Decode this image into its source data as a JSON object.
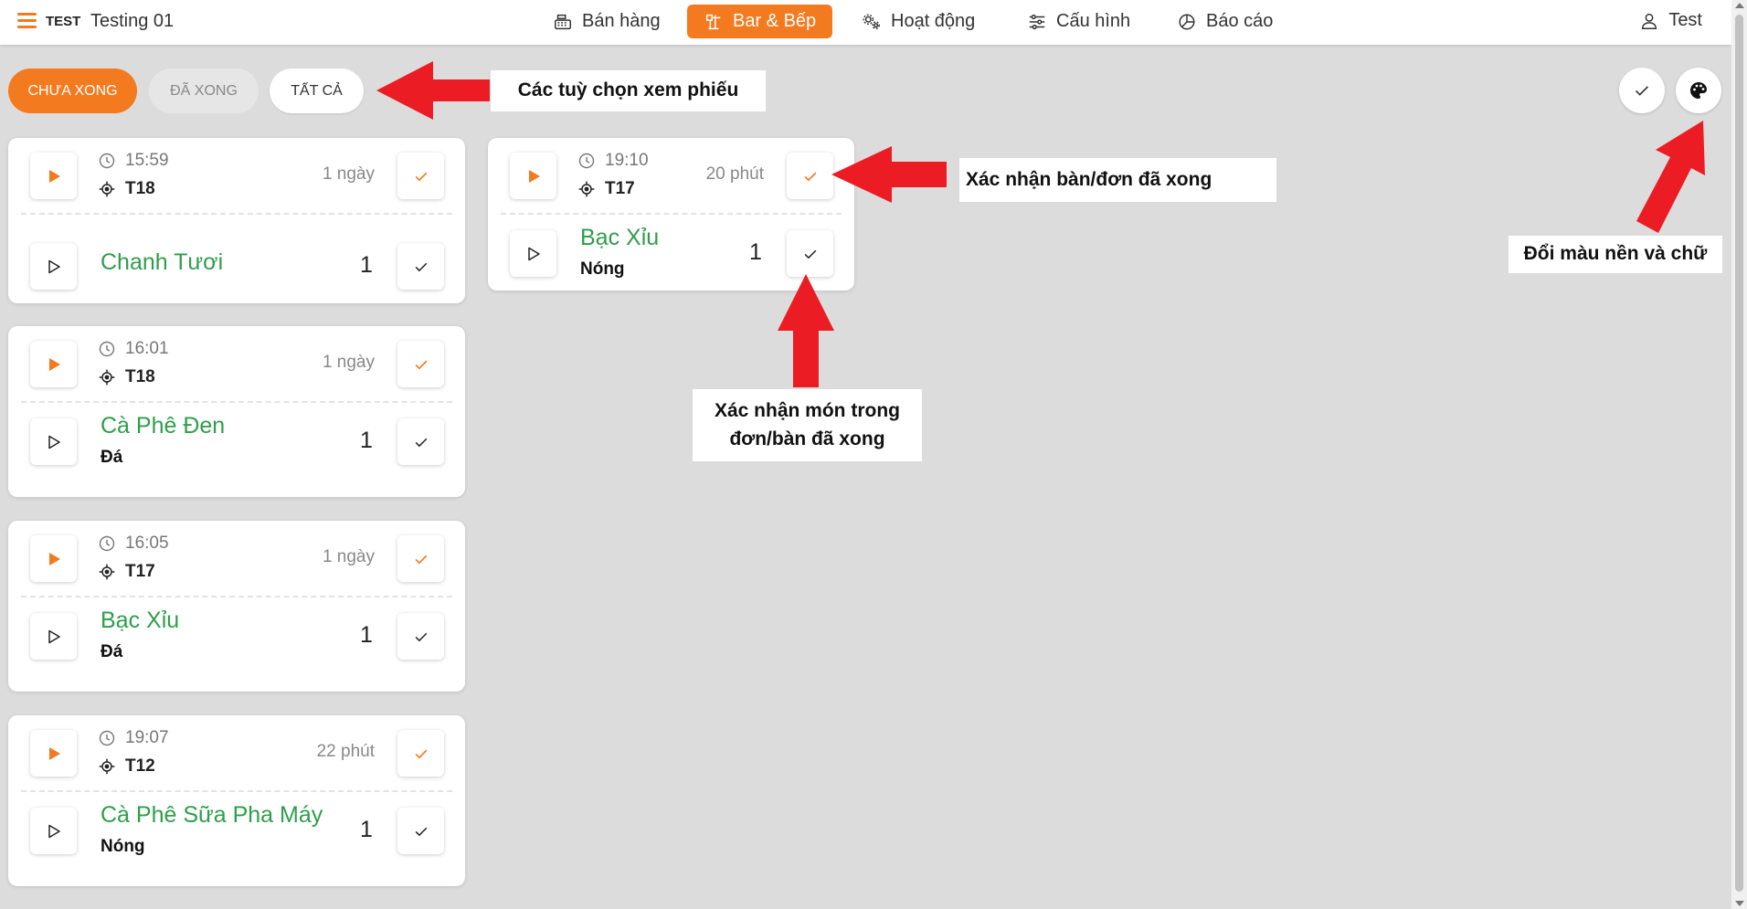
{
  "header": {
    "brand": "TEST",
    "store_name": "Testing 01",
    "nav": [
      {
        "label": "Bán hàng",
        "icon": "cash-register-icon"
      },
      {
        "label": "Bar & Bếp",
        "icon": "chef-icon",
        "active": true
      },
      {
        "label": "Hoạt động",
        "icon": "gears-icon"
      },
      {
        "label": "Cấu hình",
        "icon": "sliders-icon"
      },
      {
        "label": "Báo cáo",
        "icon": "pie-chart-icon"
      }
    ],
    "user_name": "Test"
  },
  "filters": {
    "pending": "CHƯA XONG",
    "done": "ĐÃ XONG",
    "all": "TẤT CẢ"
  },
  "colors": {
    "accent": "#f47a1f",
    "item_green": "#2e9e4a",
    "arrow_red": "#ec1c24"
  },
  "tickets": [
    {
      "time": "15:59",
      "table": "T18",
      "ago": "1 ngày",
      "items": [
        {
          "name": "Chanh Tươi",
          "note": "",
          "qty": "1"
        }
      ]
    },
    {
      "time": "16:01",
      "table": "T18",
      "ago": "1 ngày",
      "items": [
        {
          "name": "Cà Phê Đen",
          "note": "Đá",
          "qty": "1"
        }
      ]
    },
    {
      "time": "16:05",
      "table": "T17",
      "ago": "1 ngày",
      "items": [
        {
          "name": "Bạc Xỉu",
          "note": "Đá",
          "qty": "1"
        }
      ]
    },
    {
      "time": "19:07",
      "table": "T12",
      "ago": "22 phút",
      "items": [
        {
          "name": "Cà Phê Sữa Pha Máy",
          "note": "Nóng",
          "qty": "1"
        }
      ]
    },
    {
      "time": "19:10",
      "table": "T17",
      "ago": "20 phút",
      "items": [
        {
          "name": "Bạc Xỉu",
          "note": "Nóng",
          "qty": "1"
        }
      ]
    }
  ],
  "annotations": {
    "view_options": "Các tuỳ chọn xem phiếu",
    "confirm_ticket": "Xác nhận bàn/đơn đã xong",
    "confirm_item_line1": "Xác nhận món trong",
    "confirm_item_line2": "đơn/bàn đã xong",
    "change_colors": "Đổi màu nền và chữ"
  }
}
